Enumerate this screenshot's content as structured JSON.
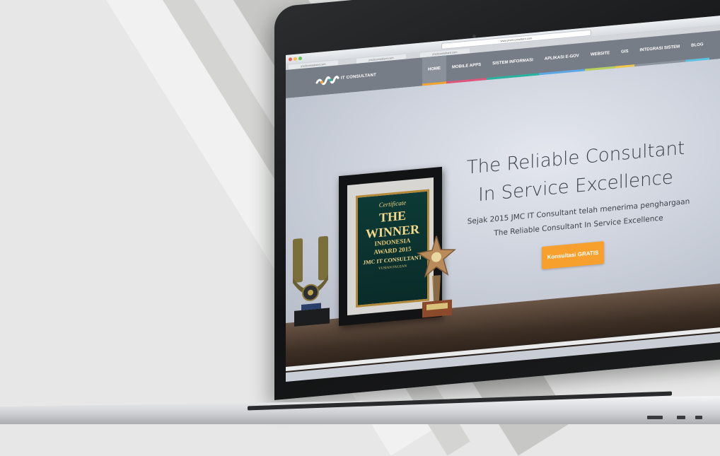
{
  "browser": {
    "url": "www.jmcitconsultant.com",
    "tabs": [
      "jmcitconsultant.com",
      "jmcitconsultant.com",
      "jmcitconsultant.com"
    ]
  },
  "site": {
    "logo_text": "IT CONSULTANT",
    "nav": [
      {
        "label": "HOME",
        "color": "#f2a52c"
      },
      {
        "label": "MOBILE APPS",
        "color": "#e0557a"
      },
      {
        "label": "SISTEM INFORMASI",
        "color": "#26b4a0"
      },
      {
        "label": "APLIKASI E-GOV",
        "color": "#5aa8e8"
      },
      {
        "label": "WEBSITE",
        "color": "#b9d15a"
      },
      {
        "label": "GIS",
        "color": "#f0c84a"
      },
      {
        "label": "INTEGRASI SISTEM",
        "color": "#8c959f"
      },
      {
        "label": "BLOG",
        "color": "#5ac1e0"
      }
    ],
    "hero": {
      "title_line1": "The Reliable Consultant",
      "title_line2": "In Service Excellence",
      "sub_line1": "Sejak 2015 JMC IT Consultant telah menerima penghargaan",
      "sub_line2": "The Reliable Consultant In Service Excellence",
      "cta_label": "Konsultasi GRATIS"
    },
    "certificate": {
      "heading": "Certificate",
      "winner_line1": "THE",
      "winner_line2": "WINNER",
      "winner_line3": "INDONESIA",
      "winner_line4": "AWARD 2015",
      "awardee": "JMC IT CONSULTANT",
      "person": "YUSIAN FAUZAN"
    }
  },
  "colors": {
    "accent": "#f7a02e",
    "header": "#707680",
    "laptop_body": "#1a1b1c"
  }
}
